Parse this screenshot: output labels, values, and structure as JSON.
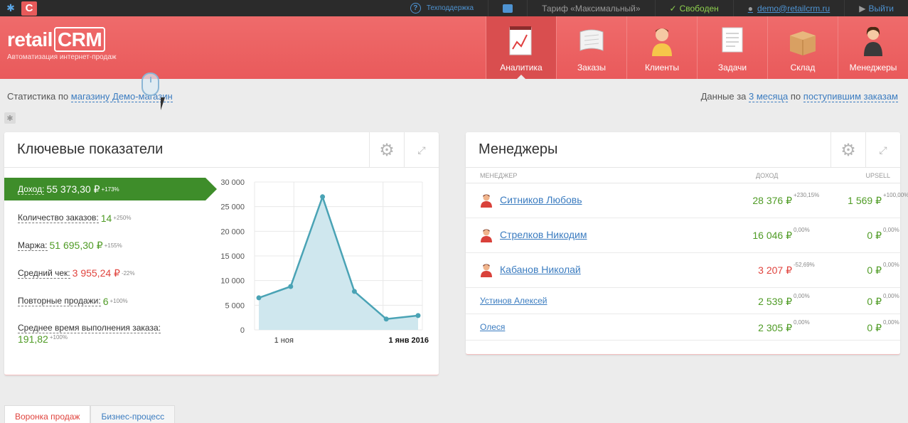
{
  "topbar": {
    "support": "Техподдержка",
    "tariff": "Тариф «Максимальный»",
    "status": "Свободен",
    "user_email": "demo@retailcrm.ru",
    "logout": "Выйти"
  },
  "brand": {
    "name_prefix": "retail",
    "name_suffix": "CRM",
    "tagline": "Автоматизация интернет-продаж"
  },
  "nav": [
    {
      "label": "Аналитика",
      "icon": "analytics-icon",
      "active": true
    },
    {
      "label": "Заказы",
      "icon": "orders-icon",
      "active": false
    },
    {
      "label": "Клиенты",
      "icon": "clients-icon",
      "active": false
    },
    {
      "label": "Задачи",
      "icon": "tasks-icon",
      "active": false
    },
    {
      "label": "Склад",
      "icon": "warehouse-icon",
      "active": false
    },
    {
      "label": "Менеджеры",
      "icon": "managers-icon",
      "active": false
    }
  ],
  "stat_line": {
    "prefix": "Статистика по",
    "link": "магазину Демо-магазин"
  },
  "data_line": {
    "prefix": "Данные за",
    "period": "3 месяца",
    "middle": "по",
    "basis": "поступившим заказам"
  },
  "kpi_panel": {
    "title": "Ключевые показатели",
    "items": [
      {
        "label": "Доход:",
        "value": "55 373,30 ₽",
        "change": "+173%",
        "color": "green"
      },
      {
        "label": "Количество заказов:",
        "value": "14",
        "change": "+250%",
        "color": "green"
      },
      {
        "label": "Маржа:",
        "value": "51 695,30 ₽",
        "change": "+155%",
        "color": "green"
      },
      {
        "label": "Средний чек:",
        "value": "3 955,24 ₽",
        "change": "-22%",
        "color": "red"
      },
      {
        "label": "Повторные продажи:",
        "value": "6",
        "change": "+100%",
        "color": "green"
      },
      {
        "label": "Среднее время выполнения заказа:",
        "value": "191,82",
        "change": "+100%",
        "color": "green"
      }
    ]
  },
  "chart_data": {
    "type": "area",
    "title": "",
    "xlabel": "",
    "ylabel": "",
    "ylim": [
      0,
      30000
    ],
    "yticks": [
      0,
      5000,
      10000,
      15000,
      20000,
      25000,
      30000
    ],
    "ytick_labels": [
      "0",
      "5 000",
      "10 000",
      "15 000",
      "20 000",
      "25 000",
      "30 000"
    ],
    "xtick_labels": [
      "1 ноя",
      "1 янв 2016"
    ],
    "grid": true,
    "legend": "none",
    "color": "#4aa3b5",
    "fill": "#cfe7ee",
    "points": [
      {
        "x": 0,
        "y": 6500
      },
      {
        "x": 1,
        "y": 8800
      },
      {
        "x": 2,
        "y": 27000
      },
      {
        "x": 3,
        "y": 7800
      },
      {
        "x": 4,
        "y": 2200
      },
      {
        "x": 5,
        "y": 2900
      }
    ]
  },
  "managers_panel": {
    "title": "Менеджеры",
    "columns": [
      "МЕНЕДЖЕР",
      "ДОХОД",
      "UPSELL"
    ],
    "rows": [
      {
        "name": "Ситников Любовь",
        "income": "28 376 ₽",
        "income_change": "+230,15%",
        "income_color": "green",
        "upsell": "1 569 ₽",
        "upsell_change": "+100,00%",
        "avatar": true
      },
      {
        "name": "Стрелков Никодим",
        "income": "16 046 ₽",
        "income_change": "0,00%",
        "income_color": "green",
        "upsell": "0 ₽",
        "upsell_change": "0,00%",
        "avatar": true
      },
      {
        "name": "Кабанов Николай",
        "income": "3 207 ₽",
        "income_change": "-52,69%",
        "income_color": "red",
        "upsell": "0 ₽",
        "upsell_change": "0,00%",
        "avatar": true
      },
      {
        "name": "Устинов Алексей",
        "income": "2 539 ₽",
        "income_change": "0,00%",
        "income_color": "green",
        "upsell": "0 ₽",
        "upsell_change": "0,00%",
        "avatar": false
      },
      {
        "name": "Олеся",
        "income": "2 305 ₽",
        "income_change": "0,00%",
        "income_color": "green",
        "upsell": "0 ₽",
        "upsell_change": "0,00%",
        "avatar": false
      }
    ]
  },
  "bottom_tabs": [
    {
      "label": "Воронка продаж",
      "active": true
    },
    {
      "label": "Бизнес-процесс",
      "active": false
    }
  ]
}
